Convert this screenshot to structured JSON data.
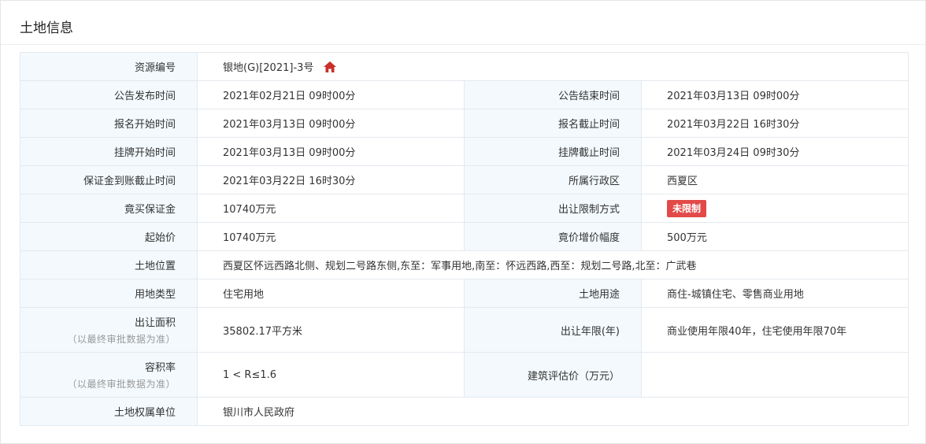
{
  "title": "土地信息",
  "colors": {
    "label_bg": "#f3f9fd",
    "badge_bg": "#e14a48",
    "home_icon": "#c9302c"
  },
  "rows": {
    "resource_no": {
      "label": "资源编号",
      "value": "银地(G)[2021]-3号",
      "icon": "home-icon"
    },
    "announce": {
      "l1": "公告发布时间",
      "v1": "2021年02月21日 09时00分",
      "l2": "公告结束时间",
      "v2": "2021年03月13日 09时00分"
    },
    "signup": {
      "l1": "报名开始时间",
      "v1": "2021年03月13日 09时00分",
      "l2": "报名截止时间",
      "v2": "2021年03月22日 16时30分"
    },
    "listing": {
      "l1": "挂牌开始时间",
      "v1": "2021年03月13日 09时00分",
      "l2": "挂牌截止时间",
      "v2": "2021年03月24日 09时30分"
    },
    "deposit_deadline": {
      "l1": "保证金到账截止时间",
      "v1": "2021年03月22日 16时30分",
      "l2": "所属行政区",
      "v2": "西夏区"
    },
    "deposit": {
      "l1": "竟买保证金",
      "v1": "10740万元",
      "l2": "出让限制方式",
      "v2": "未限制"
    },
    "start_price": {
      "l1": "起始价",
      "v1": "10740万元",
      "l2": "竟价增价幅度",
      "v2": "500万元"
    },
    "location": {
      "label": "土地位置",
      "value": "西夏区怀远西路北侧、规划二号路东侧,东至：军事用地,南至：怀远西路,西至：规划二号路,北至：广武巷"
    },
    "land_type": {
      "l1": "用地类型",
      "v1": "住宅用地",
      "l2": "土地用途",
      "v2": "商住-城镇住宅、零售商业用地"
    },
    "area": {
      "l1": "出让面积",
      "l1_note": "（以最终审批数据为准）",
      "v1": "35802.17平方米",
      "l2": "出让年限(年)",
      "v2": "商业使用年限40年，住宅使用年限70年"
    },
    "far": {
      "l1": "容积率",
      "l1_note": "（以最终审批数据为准）",
      "v1": "1 < R≤1.6",
      "l2": "建筑评估价（万元）",
      "v2": ""
    },
    "owner": {
      "label": "土地权属单位",
      "value": "银川市人民政府"
    }
  }
}
